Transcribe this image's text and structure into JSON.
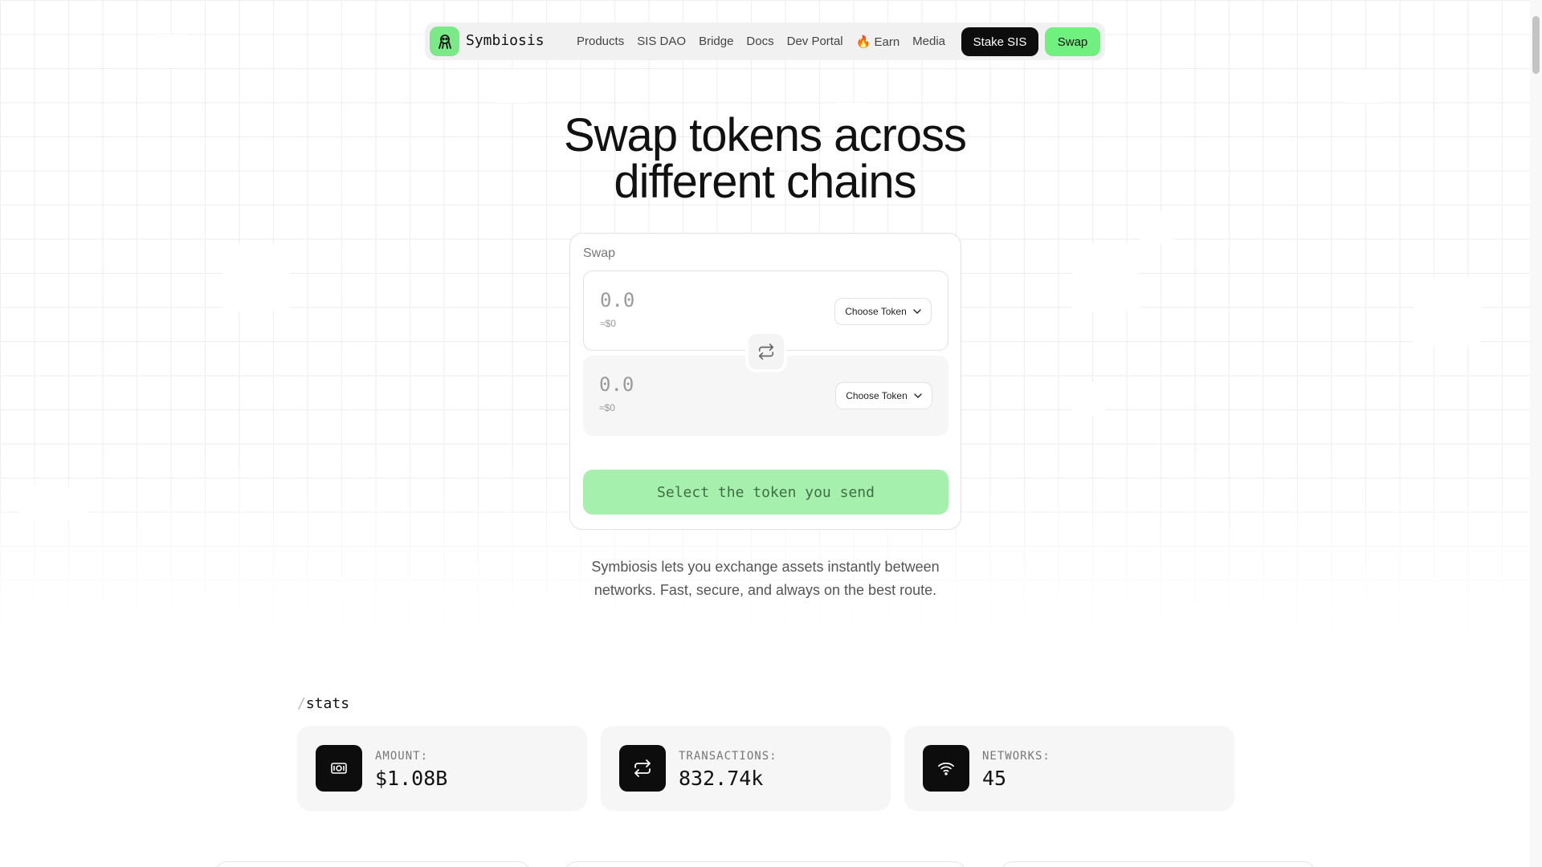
{
  "brand": {
    "name": "Symbiosis",
    "color": "#7be987"
  },
  "nav": {
    "links": [
      "Products",
      "SIS DAO",
      "Bridge",
      "Docs",
      "Dev Portal",
      "🔥 Earn",
      "Media"
    ],
    "stake_label": "Stake SIS",
    "swap_label": "Swap"
  },
  "hero": {
    "line1": "Swap tokens across",
    "line2": "different chains"
  },
  "swap_card": {
    "title": "Swap",
    "from": {
      "amount": "0.0",
      "usd": "≈$0",
      "token_label": "Choose Token"
    },
    "to": {
      "amount": "0.0",
      "usd": "≈$0",
      "token_label": "Choose Token"
    },
    "cta_label": "Select the token you send"
  },
  "tagline": {
    "line1": "Symbiosis lets you exchange assets instantly between",
    "line2": "networks. Fast, secure, and always on the best route."
  },
  "stats": {
    "heading_prefix": "/",
    "heading": "stats",
    "items": [
      {
        "label": "AMOUNT:",
        "value": "$1.08B",
        "icon": "cash-icon"
      },
      {
        "label": "TRANSACTIONS:",
        "value": "832.74k",
        "icon": "repeat-icon"
      },
      {
        "label": "NETWORKS:",
        "value": "45",
        "icon": "wifi-icon"
      }
    ]
  },
  "colors": {
    "accent": "#6ff07f",
    "cta_bg": "#a6f0ae",
    "dark": "#0d0d0d"
  }
}
